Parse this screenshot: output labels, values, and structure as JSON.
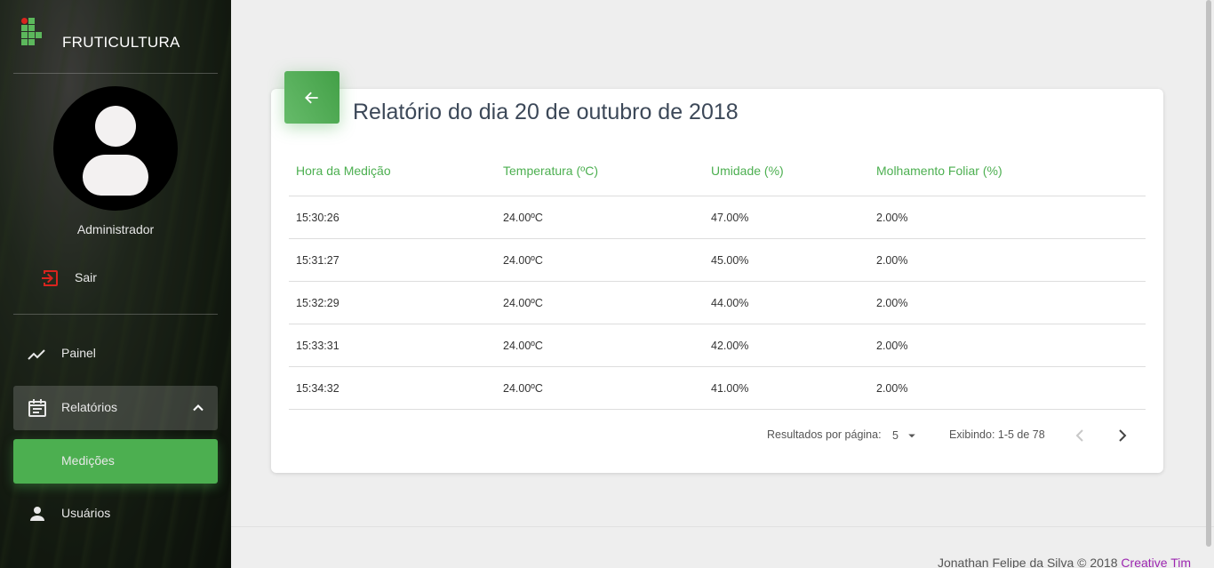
{
  "brand": "FRUTICULTURA",
  "user": {
    "name": "Administrador"
  },
  "sidebar": {
    "logout_label": "Sair",
    "items": [
      {
        "label": "Painel",
        "icon": "trending-up-icon"
      },
      {
        "label": "Relatórios",
        "icon": "calendar-icon",
        "expanded": true
      },
      {
        "label": "Medições",
        "active": true
      },
      {
        "label": "Usuários",
        "icon": "person-icon"
      }
    ]
  },
  "report": {
    "title": "Relatório do dia 20 de outubro de 2018",
    "columns": [
      "Hora da Medição",
      "Temperatura (ºC)",
      "Umidade (%)",
      "Molhamento Foliar (%)"
    ],
    "rows": [
      [
        "15:30:26",
        "24.00ºC",
        "47.00%",
        "2.00%"
      ],
      [
        "15:31:27",
        "24.00ºC",
        "45.00%",
        "2.00%"
      ],
      [
        "15:32:29",
        "24.00ºC",
        "44.00%",
        "2.00%"
      ],
      [
        "15:33:31",
        "24.00ºC",
        "42.00%",
        "2.00%"
      ],
      [
        "15:34:32",
        "24.00ºC",
        "41.00%",
        "2.00%"
      ]
    ],
    "pagination": {
      "per_page_label": "Resultados por página:",
      "per_page_value": "5",
      "range_label": "Exibindo: 1-5 de 78"
    }
  },
  "footer": {
    "text": "Jonathan Felipe da Silva © 2018",
    "link": "Creative Tim"
  },
  "colors": {
    "accent": "#4caf50",
    "logout_icon": "#d9241e",
    "footer_link": "#9c27b0"
  }
}
